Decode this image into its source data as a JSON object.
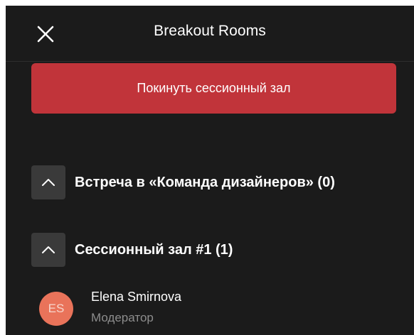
{
  "header": {
    "title": "Breakout Rooms",
    "close_icon": "close-icon"
  },
  "leave_button": {
    "label": "Покинуть сессионный зал",
    "color": "#c1343a"
  },
  "rooms": [
    {
      "label": "Встреча в «Команда дизайнеров» (0)",
      "icon": "chevron-up-icon",
      "expanded": true
    },
    {
      "label": "Сессионный зал #1 (1)",
      "icon": "chevron-up-icon",
      "expanded": true,
      "participants": [
        {
          "initials": "ES",
          "name": "Elena Smirnova",
          "role": "Модератор",
          "avatar_color": "#e9735a"
        }
      ]
    }
  ],
  "colors": {
    "background": "#1b1b1b",
    "text": "#ffffff",
    "muted_text": "#8d8d8d",
    "chevron_box": "#3a3a3a"
  }
}
